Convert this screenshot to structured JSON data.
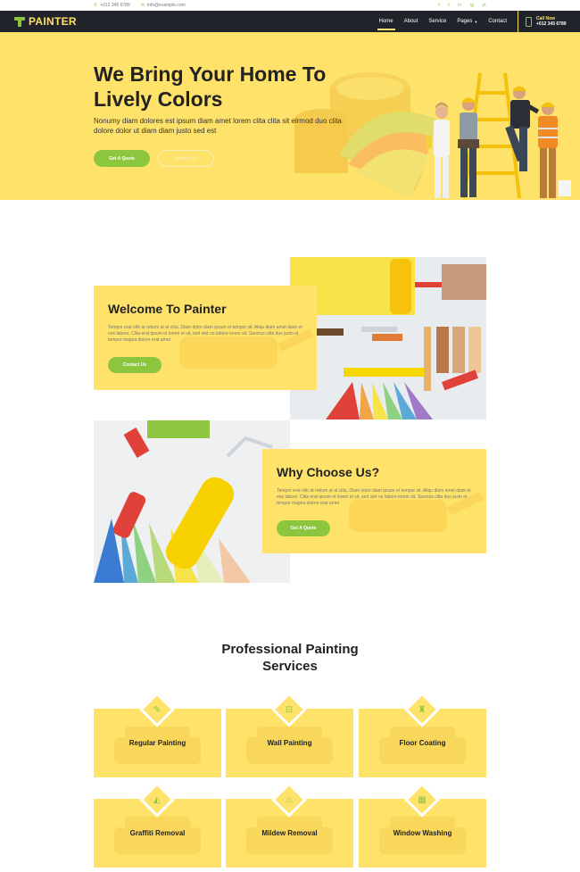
{
  "topbar": {
    "phone": "+012 345 6789",
    "email": "info@example.com",
    "social": [
      "f",
      "t",
      "in",
      "ig",
      "yt"
    ]
  },
  "nav": {
    "logo": "PAINTER",
    "items": [
      "Home",
      "About",
      "Service",
      "Pages",
      "Contact"
    ],
    "active": "Home",
    "call_label": "Call Now",
    "call_number": "+012 345 6789"
  },
  "hero": {
    "title_line1": "We Bring Your Home To",
    "title_line2": "Lively Colors",
    "text": "Nonumy diam dolores est ipsum diam amet lorem clita clita sit eirmod duo clita dolore dolor ut diam diam justo sed est",
    "btn_primary": "Get A Quote",
    "btn_secondary": "Contact Us"
  },
  "welcome": {
    "title": "Welcome To Painter",
    "text": "Tempor erat elitr at rebum at at clita. Diam dolor diam ipsum et tempor sit. Aliqu diam amet diam et eos labore. Clita erat ipsum et lorem et sit, sed stet no labore lorem sit. Sanctus clita duo justo et tempor magna dolore erat amet",
    "button": "Contact Us"
  },
  "why": {
    "title": "Why Choose Us?",
    "text": "Tempor erat elitr at rebum at at clita. Diam dolor diam ipsum et tempor sit. Aliqu diam amet diam et eos labore. Clita erat ipsum et lorem et sit, sed stet no labore lorem sit. Sanctus clita duo justo et tempor magna dolore erat amet",
    "button": "Get A Quote"
  },
  "services": {
    "title_line1": "Professional Painting",
    "title_line2": "Services",
    "items": [
      {
        "label": "Regular Painting",
        "icon": "brush-icon"
      },
      {
        "label": "Wall Painting",
        "icon": "roller-icon"
      },
      {
        "label": "Floor Coating",
        "icon": "paint-bucket-icon"
      },
      {
        "label": "Graffiti Removal",
        "icon": "eraser-icon"
      },
      {
        "label": "Mildew Removal",
        "icon": "spray-icon"
      },
      {
        "label": "Window Washing",
        "icon": "window-icon"
      }
    ]
  },
  "colors": {
    "accent_yellow": "#ffe26a",
    "accent_green": "#8cc63f",
    "dark": "#20232a"
  }
}
